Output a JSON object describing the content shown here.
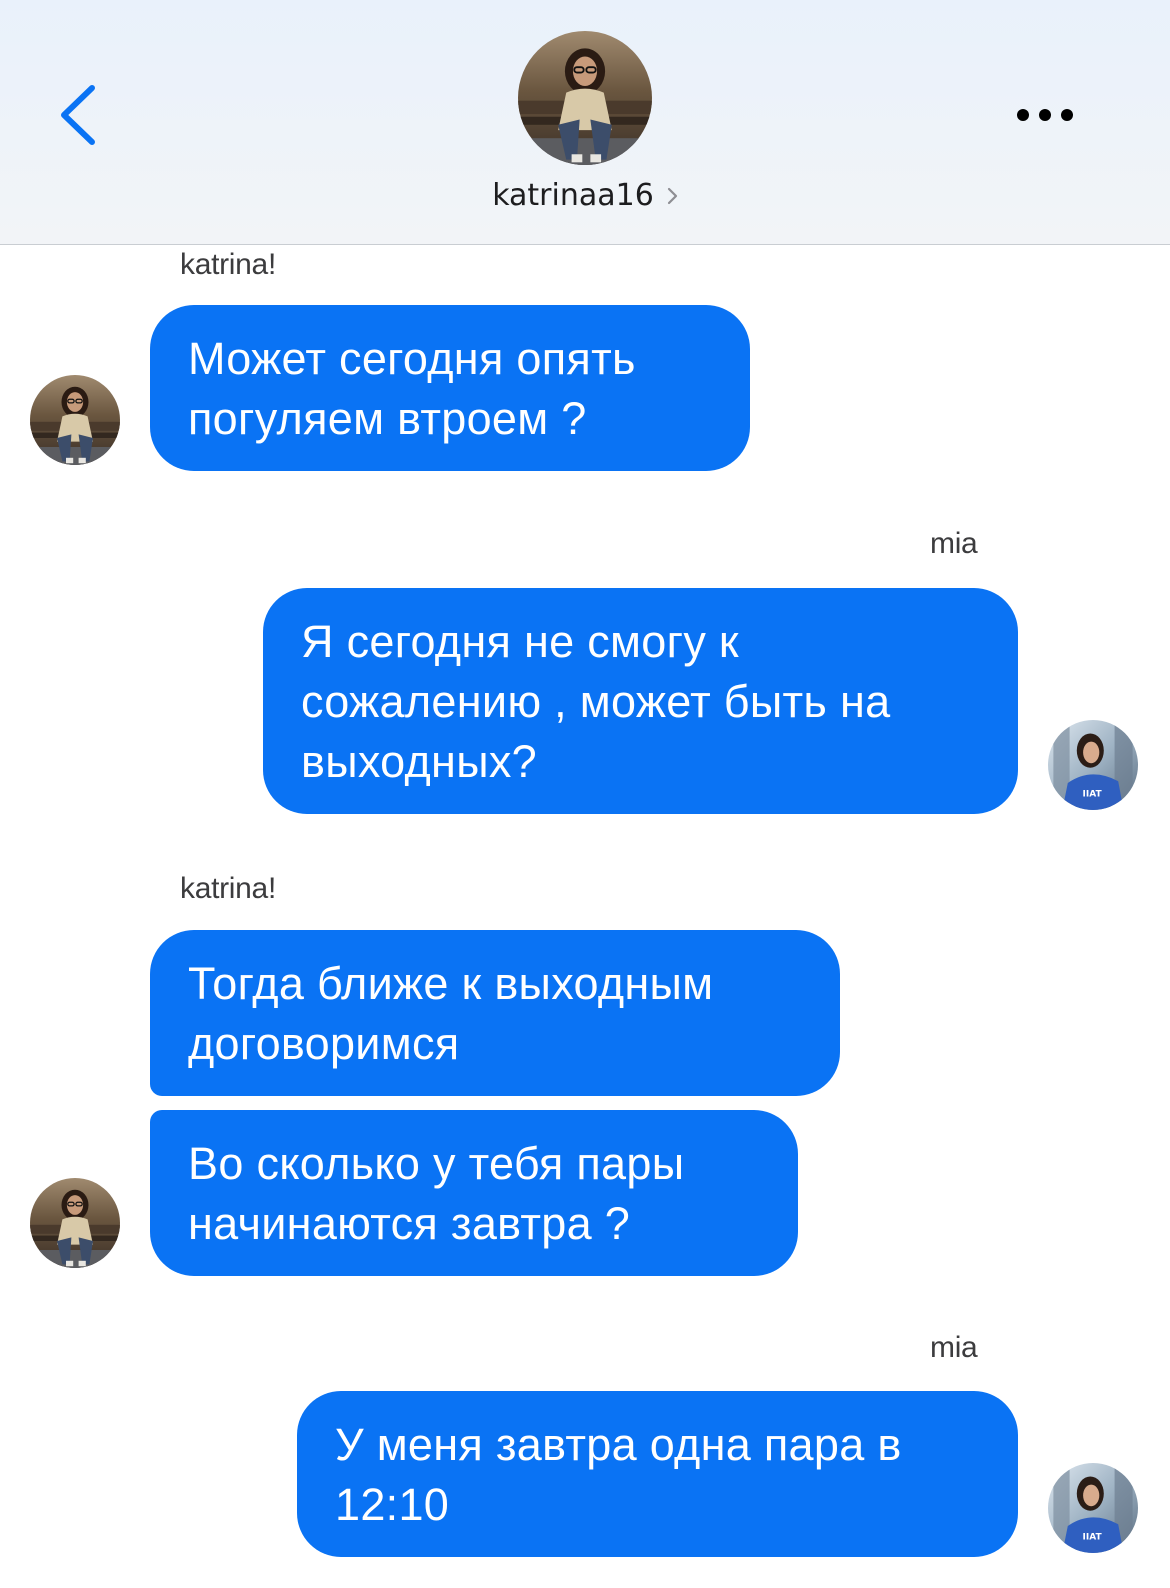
{
  "header": {
    "username": "katrinaa16",
    "back_icon": "chevron-left-icon",
    "more_icon": "ellipsis-icon",
    "accent_color": "#0a73f4"
  },
  "messages": [
    {
      "sender_label": "katrina!",
      "direction": "incoming",
      "bubbles": [
        {
          "lines": [
            "Может сегодня опять",
            "погуляем втроем ?"
          ]
        }
      ]
    },
    {
      "sender_label": "mia",
      "direction": "outgoing",
      "bubbles": [
        {
          "lines": [
            "Я сегодня не смогу к",
            "сожалению , может быть на",
            "выходных?"
          ]
        }
      ]
    },
    {
      "sender_label": "katrina!",
      "direction": "incoming",
      "bubbles": [
        {
          "lines": [
            "Тогда ближе к выходным",
            "договоримся"
          ]
        },
        {
          "lines": [
            "Во сколько у тебя пары",
            "начинаются завтра ?"
          ]
        }
      ]
    },
    {
      "sender_label": "mia",
      "direction": "outgoing",
      "bubbles": [
        {
          "lines": [
            "У меня завтра одна пара в",
            "12:10"
          ]
        }
      ]
    }
  ],
  "colors": {
    "bubble": "#0a73f4",
    "bubble_text": "#ffffff",
    "header_bg": "#eef3f9"
  }
}
